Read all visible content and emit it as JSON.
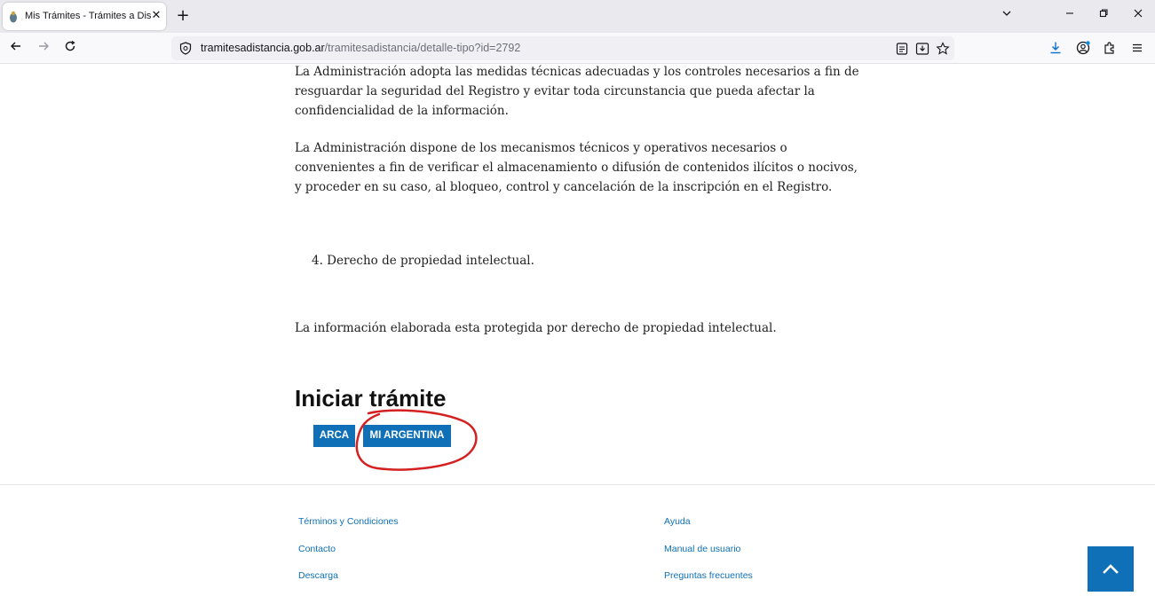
{
  "browser": {
    "tab_title": "Mis Trámites - Trámites a Distan",
    "tab_close": "✕",
    "new_tab": "+",
    "url_host": "tramitesadistancia.gob.ar",
    "url_path": "/tramitesadistancia/detalle-tipo?id=2792"
  },
  "content": {
    "para1": "La Administración adopta las medidas técnicas adecuadas y los controles necesarios a fin de resguardar la seguridad del Registro y evitar toda circunstancia que pueda afectar la confidencialidad de la  información.",
    "para2": "La Administración dispone de los mecanismos técnicos y operativos necesarios o convenientes a fin de verificar el almacenamiento o difusión de contenidos ilícitos o nocivos, y proceder en su caso, al bloqueo, control y cancelación de la inscripción en el Registro.",
    "list_item": "4. Derecho de propiedad intelectual.",
    "para3": "La información elaborada esta protegida por derecho de propiedad intelectual."
  },
  "iniciar": {
    "title": "Iniciar trámite",
    "btn_arca": "ARCA",
    "btn_mi_argentina": "MI ARGENTINA"
  },
  "footer": {
    "terminos": "Términos y Condiciones",
    "contacto": "Contacto",
    "descarga": "Descarga",
    "ayuda": "Ayuda",
    "manual": "Manual de usuario",
    "preguntas": "Preguntas frecuentes"
  },
  "colors": {
    "primary_blue": "#0f70b7",
    "annotation_red": "#d42020"
  },
  "icons": {
    "favicon": "argentina-coat-of-arms-icon",
    "back_to_top": "chevron-up-icon"
  }
}
